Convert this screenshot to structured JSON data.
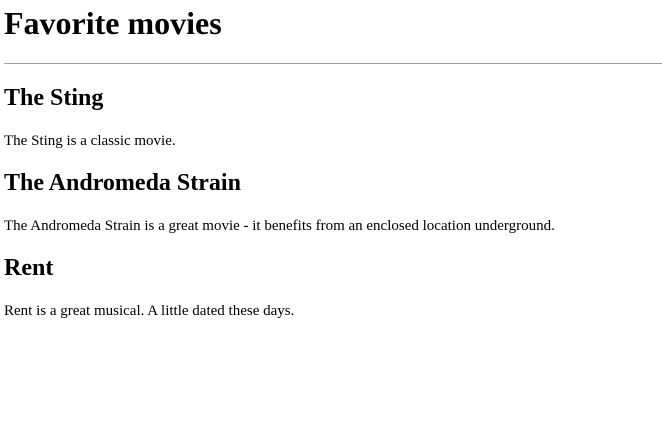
{
  "page": {
    "title": "Favorite movies"
  },
  "movies": [
    {
      "title": "The Sting",
      "description": "The Sting is a classic movie."
    },
    {
      "title": "The Andromeda Strain",
      "description": "The Andromeda Strain is a great movie - it benefits from an enclosed location underground."
    },
    {
      "title": "Rent",
      "description": "Rent is a great musical. A little dated these days."
    }
  ]
}
